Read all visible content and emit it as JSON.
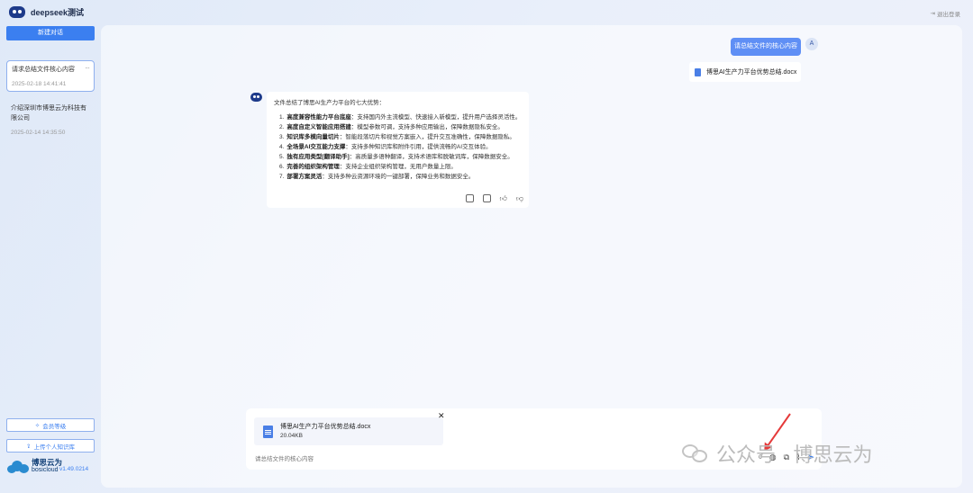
{
  "app": {
    "title": "deepseek测试",
    "logout": "退出登录"
  },
  "sidebar": {
    "new_chat": "新建对话",
    "conversations": [
      {
        "title": "请求总结文件核心内容",
        "time": "2025-02-18 14:41:41",
        "more": "···"
      },
      {
        "title": "介绍深圳市博思云为科技有限公司",
        "time": "2025-02-14 14:35:50"
      }
    ],
    "membership": "会员等级",
    "upload": "上传个人知识库",
    "brand_cn": "博思云为",
    "brand_en": "bosicloud",
    "version": "v1.49.0214"
  },
  "chat": {
    "user_message": "请总结文件的核心内容",
    "user_avatar": "A",
    "user_file": "博思AI生产力平台优势总结.docx",
    "bot_intro": "文件总结了博思AI生产力平台的七大优势：",
    "bot_points": [
      {
        "n": "1.",
        "head": "高度兼容性能力平台底座",
        "body": "：支持国内外主流模型、快速接入新模型，提升用户选择灵活性。"
      },
      {
        "n": "2.",
        "head": "高度自定义智能应用搭建",
        "body": "：模型参数可调，支持多种应用输出，保障数据隐私安全。"
      },
      {
        "n": "3.",
        "head": "知识库多模向量切片",
        "body": "：智能段落切片和视觉方案嵌入，提升交互准确性，保障数据隐私。"
      },
      {
        "n": "4.",
        "head": "全场景AI交互能力支撑",
        "body": "：支持多种知识库和附件引用，提供流畅的AI交互体验。"
      },
      {
        "n": "5.",
        "head": "独有应用类型[翻译助手]",
        "body": "：高质量多语种翻译，支持术语库和脱敏词库，保障数据安全。"
      },
      {
        "n": "6.",
        "head": "完善的组织架构管理",
        "body": "：支持企业组织架构管理，无用户数量上限。"
      },
      {
        "n": "7.",
        "head": "部署方案灵活",
        "body": "：支持多种云资源环境的一键部署，保障业务和数据安全。"
      }
    ]
  },
  "composer": {
    "attachment_name": "博思AI生产力平台优势总结.docx",
    "attachment_size": "20.04KB",
    "close": "✕",
    "placeholder": "请总结文件的核心内容",
    "count": "0"
  },
  "watermark": "公众号 · 博思云为"
}
